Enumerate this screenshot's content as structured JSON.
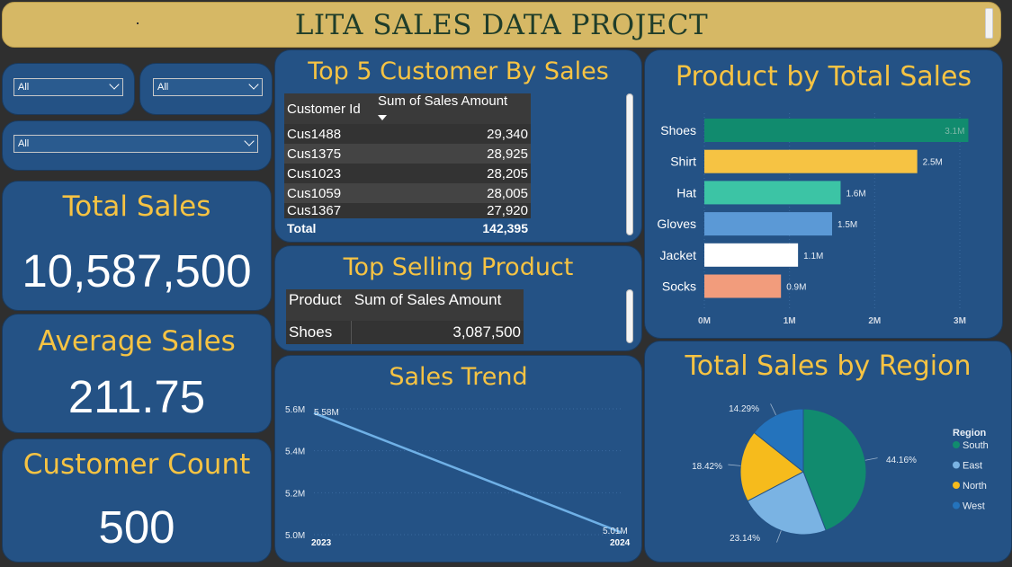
{
  "header": {
    "title": "LITA SALES DATA PROJECT"
  },
  "filters": {
    "slicer1": "All",
    "slicer2": "All",
    "slicer3": "All"
  },
  "kpis": {
    "total_sales": {
      "label": "Total Sales",
      "value": "10,587,500"
    },
    "average_sales": {
      "label": "Average Sales",
      "value": "211.75"
    },
    "customer_count": {
      "label": "Customer Count",
      "value": "500"
    }
  },
  "top_customers": {
    "title": "Top 5 Customer By Sales",
    "columns": [
      "Customer Id",
      "Sum of Sales Amount"
    ],
    "rows": [
      {
        "id": "Cus1488",
        "amount": "29,340"
      },
      {
        "id": "Cus1375",
        "amount": "28,925"
      },
      {
        "id": "Cus1023",
        "amount": "28,205"
      },
      {
        "id": "Cus1059",
        "amount": "28,005"
      },
      {
        "id": "Cus1367",
        "amount": "27,920"
      }
    ],
    "total_label": "Total",
    "total_value": "142,395"
  },
  "top_product": {
    "title": "Top Selling Product",
    "columns": [
      "Product",
      "Sum of Sales Amount"
    ],
    "rows": [
      {
        "product": "Shoes",
        "amount": "3,087,500"
      }
    ]
  },
  "chart_data": [
    {
      "type": "bar",
      "orientation": "horizontal",
      "title": "Product by Total Sales",
      "categories": [
        "Shoes",
        "Shirt",
        "Hat",
        "Gloves",
        "Jacket",
        "Socks"
      ],
      "values": [
        3.1,
        2.5,
        1.6,
        1.5,
        1.1,
        0.9
      ],
      "value_labels": [
        "3.1M",
        "2.5M",
        "1.6M",
        "1.5M",
        "1.1M",
        "0.9M"
      ],
      "colors": [
        "#118b6e",
        "#f6c343",
        "#3cc4a5",
        "#5b99d6",
        "#ffffff",
        "#f29c7c"
      ],
      "xlim": [
        0,
        3
      ],
      "xticks": [
        "0M",
        "1M",
        "2M",
        "3M"
      ]
    },
    {
      "type": "line",
      "title": "Sales Trend",
      "x": [
        "2023",
        "2024"
      ],
      "values": [
        5.58,
        5.01
      ],
      "value_labels": [
        "5.58M",
        "5.01M"
      ],
      "ylim": [
        5.0,
        5.6
      ],
      "yticks": [
        "5.0M",
        "5.2M",
        "5.4M",
        "5.6M"
      ],
      "color": "#6fb0e6"
    },
    {
      "type": "pie",
      "title": "Total Sales by Region",
      "legend_title": "Region",
      "legend_position": "right",
      "labels": [
        "South",
        "East",
        "North",
        "West"
      ],
      "values": [
        44.16,
        23.14,
        18.42,
        14.29
      ],
      "value_labels": [
        "44.16%",
        "23.14%",
        "18.42%",
        "14.29%"
      ],
      "colors": [
        "#118b6e",
        "#7ab3e3",
        "#f6bb1c",
        "#2473bc"
      ]
    }
  ]
}
